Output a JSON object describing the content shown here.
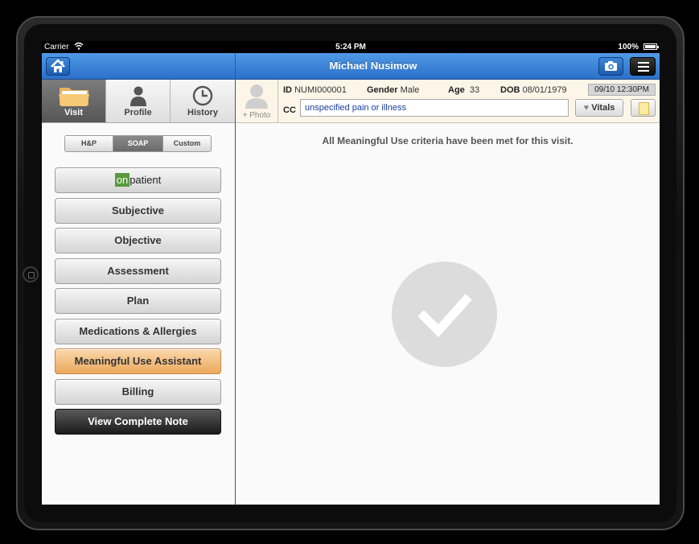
{
  "status_bar": {
    "carrier": "Carrier",
    "time": "5:24 PM",
    "battery": "100%"
  },
  "header": {
    "patient_name": "Michael Nusimow"
  },
  "left_tabs": [
    {
      "label": "Visit",
      "icon": "folder-icon",
      "active": true
    },
    {
      "label": "Profile",
      "icon": "person-icon",
      "active": false
    },
    {
      "label": "History",
      "icon": "clock-icon",
      "active": false
    }
  ],
  "segments": [
    {
      "label": "H&P",
      "active": false
    },
    {
      "label": "SOAP",
      "active": true
    },
    {
      "label": "Custom",
      "active": false
    }
  ],
  "nav": {
    "onpatient_on": "on",
    "onpatient_rest": "patient",
    "subjective": "Subjective",
    "objective": "Objective",
    "assessment": "Assessment",
    "plan": "Plan",
    "medications": "Medications & Allergies",
    "meaningful_use": "Meaningful Use Assistant",
    "billing": "Billing",
    "view_note": "View Complete Note"
  },
  "patient": {
    "photo_label": "+ Photo",
    "id_label": "ID",
    "id_value": "NUMI000001",
    "gender_label": "Gender",
    "gender_value": "Male",
    "age_label": "Age",
    "age_value": "33",
    "dob_label": "DOB",
    "dob_value": "08/01/1979",
    "visit_datetime": "09/10 12:30PM",
    "cc_label": "CC",
    "cc_value": "unspecified pain or illness",
    "vitals_label": "Vitals"
  },
  "main": {
    "message": "All Meaningful Use criteria have been met for this visit."
  },
  "colors": {
    "header_blue": "#2c70c9",
    "highlight_orange": "#eca95e",
    "onpatient_green": "#5a9a3c"
  }
}
